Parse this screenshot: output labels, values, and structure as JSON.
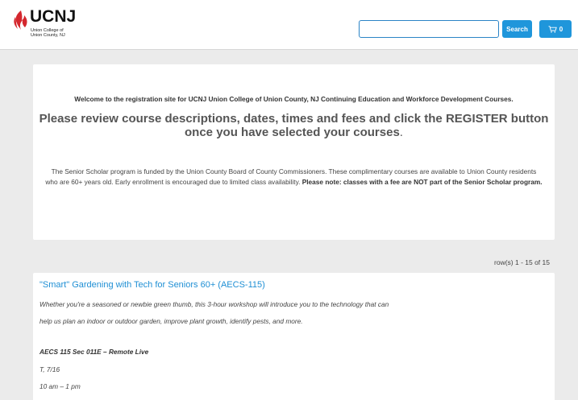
{
  "header": {
    "logo": {
      "brand": "UCNJ",
      "sub_line1": "Union College of",
      "sub_line2": "Union County, NJ",
      "flame_color": "#d4272e"
    },
    "search": {
      "value": "",
      "placeholder": "",
      "button_label": "Search"
    },
    "cart": {
      "count": "0"
    },
    "accent_color": "#1f96db"
  },
  "welcome": {
    "intro": "Welcome to the registration site for UCNJ Union College of Union County, NJ Continuing Education and Workforce Development Courses.",
    "headline_main": "Please review course descriptions, dates, times and fees and click the REGISTER button once you have selected your courses",
    "headline_tail": ".",
    "senior_text": "The Senior Scholar program is funded by the Union County Board of County Commissioners. These complimentary courses are available to Union County residents who are 60+ years old. Early enrollment is encouraged due to limited class availability. ",
    "senior_note": "Please note: classes with a fee are NOT part of the Senior Scholar program."
  },
  "results": {
    "row_count": "row(s) 1 - 15 of 15"
  },
  "course": {
    "title": "\"Smart\" Gardening with Tech for Seniors 60+ (AECS-115)",
    "desc_line1": "Whether you're a seasoned or newbie green thumb, this 3-hour workshop will introduce you to the technology that can",
    "desc_line2": "help us plan an indoor or outdoor garden, improve plant growth, identify pests, and more.",
    "section": "AECS 115 Sec 011E – Remote Live",
    "day": "T, 7/16",
    "time": "10 am – 1 pm"
  }
}
